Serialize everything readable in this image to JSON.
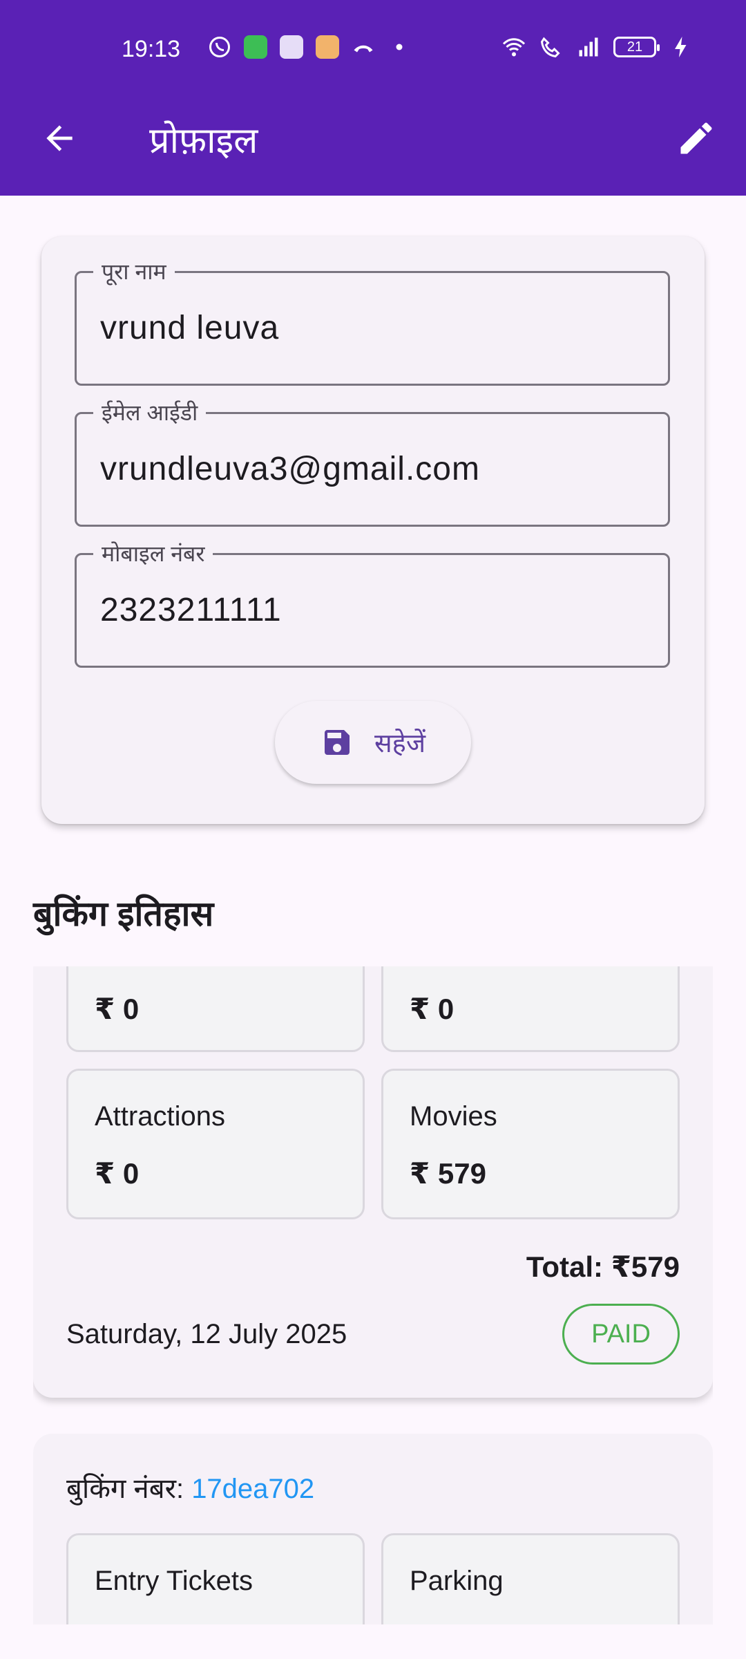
{
  "status_bar": {
    "time": "19:13",
    "battery": "21"
  },
  "app_bar": {
    "title": "प्रोफ़ाइल"
  },
  "profile": {
    "name_label": "पूरा नाम",
    "name_value": "vrund leuva",
    "email_label": "ईमेल आईडी",
    "email_value": "vrundleuva3@gmail.com",
    "mobile_label": "मोबाइल नंबर",
    "mobile_value": "2323211111",
    "save_label": "सहेजें"
  },
  "booking_history": {
    "title": "बुकिंग इतिहास",
    "card1": {
      "tiles": [
        {
          "label": "",
          "value": "₹ 0"
        },
        {
          "label": "",
          "value": "₹ 0"
        },
        {
          "label": "Attractions",
          "value": "₹ 0"
        },
        {
          "label": "Movies",
          "value": "₹ 579"
        }
      ],
      "total": "Total: ₹579",
      "date": "Saturday, 12 July 2025",
      "status": "PAID"
    },
    "card2": {
      "booking_label": "बुकिंग नंबर: ",
      "booking_id": "17dea702",
      "tiles": [
        {
          "label": "Entry Tickets"
        },
        {
          "label": "Parking"
        }
      ]
    }
  },
  "colors": {
    "primary": "#5A21B5",
    "accent": "#5D3FA0",
    "paid": "#4CAF50",
    "link": "#2196F3"
  }
}
